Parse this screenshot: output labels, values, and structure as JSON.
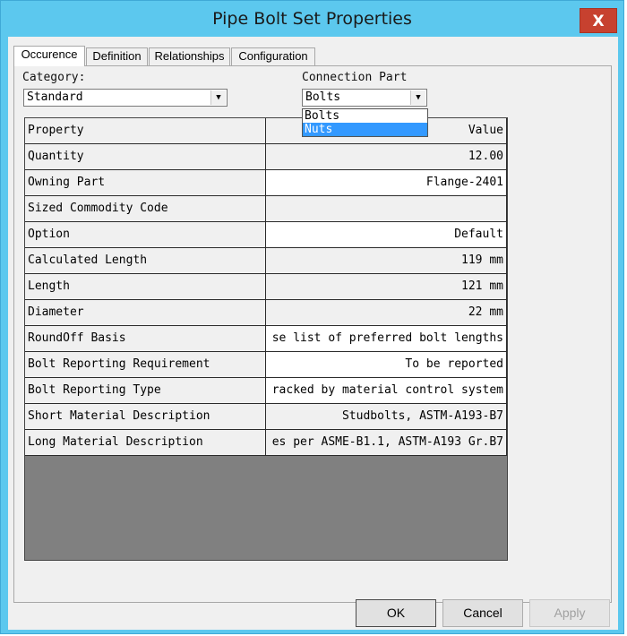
{
  "window": {
    "title": "Pipe Bolt Set Properties",
    "close_label": "X"
  },
  "tabs": [
    {
      "label": "Occurence",
      "active": true
    },
    {
      "label": "Definition",
      "active": false
    },
    {
      "label": "Relationships",
      "active": false
    },
    {
      "label": "Configuration",
      "active": false
    }
  ],
  "category": {
    "label": "Category:",
    "value": "Standard"
  },
  "connection_part": {
    "label": "Connection Part",
    "value": "Bolts",
    "options": [
      "Bolts",
      "Nuts"
    ],
    "highlighted": "Nuts"
  },
  "grid": {
    "header": {
      "property": "Property",
      "value": "Value"
    },
    "rows": [
      {
        "property": "Quantity",
        "value": "12.00"
      },
      {
        "property": "Owning Part",
        "value": "Flange-2401"
      },
      {
        "property": "Sized Commodity Code",
        "value": ""
      },
      {
        "property": "Option",
        "value": "Default"
      },
      {
        "property": "Calculated Length",
        "value": "119 mm"
      },
      {
        "property": "Length",
        "value": "121 mm"
      },
      {
        "property": "Diameter",
        "value": "22 mm"
      },
      {
        "property": "RoundOff Basis",
        "value": "se list of preferred bolt lengths"
      },
      {
        "property": "Bolt Reporting Requirement",
        "value": "To be reported"
      },
      {
        "property": "Bolt Reporting Type",
        "value": "racked by material control system"
      },
      {
        "property": "Short Material Description",
        "value": "Studbolts, ASTM-A193-B7"
      },
      {
        "property": "Long Material Description",
        "value": "es per ASME-B1.1, ASTM-A193 Gr.B7"
      }
    ]
  },
  "buttons": {
    "ok": "OK",
    "cancel": "Cancel",
    "apply": "Apply"
  },
  "colors": {
    "titlebar": "#5cc8ee",
    "close": "#c7412f",
    "selection": "#3399ff",
    "grid_empty": "#808080"
  }
}
